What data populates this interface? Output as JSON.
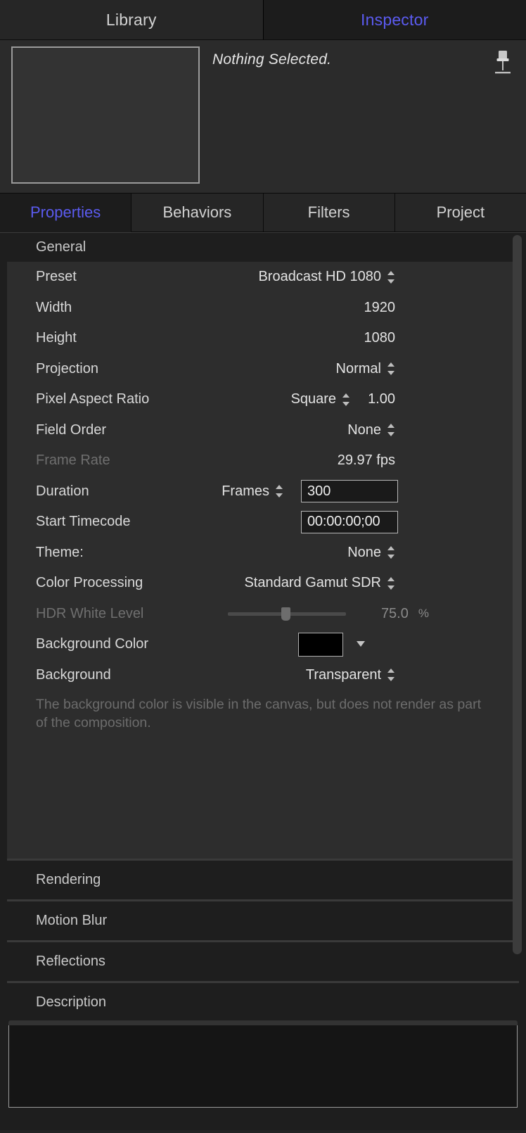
{
  "top_tabs": [
    {
      "label": "Library",
      "active": false
    },
    {
      "label": "Inspector",
      "active": true
    }
  ],
  "preview": {
    "status_text": "Nothing Selected.",
    "pin_icon": "pushpin-icon"
  },
  "inspector_tabs": [
    {
      "label": "Properties",
      "active": true
    },
    {
      "label": "Behaviors",
      "active": false
    },
    {
      "label": "Filters",
      "active": false
    },
    {
      "label": "Project",
      "active": false
    }
  ],
  "general": {
    "header": "General",
    "rows": {
      "preset": {
        "label": "Preset",
        "value": "Broadcast HD 1080"
      },
      "width": {
        "label": "Width",
        "value": "1920"
      },
      "height": {
        "label": "Height",
        "value": "1080"
      },
      "projection": {
        "label": "Projection",
        "value": "Normal"
      },
      "par": {
        "label": "Pixel Aspect Ratio",
        "value": "Square",
        "number": "1.00"
      },
      "field_order": {
        "label": "Field Order",
        "value": "None"
      },
      "frame_rate": {
        "label": "Frame Rate",
        "value": "29.97 fps"
      },
      "duration": {
        "label": "Duration",
        "unit": "Frames",
        "value": "300"
      },
      "start_tc": {
        "label": "Start Timecode",
        "value": "00:00:00;00"
      },
      "theme": {
        "label": "Theme:",
        "value": "None"
      },
      "color_proc": {
        "label": "Color Processing",
        "value": "Standard Gamut SDR"
      },
      "hdr_white": {
        "label": "HDR White Level",
        "value": "75.0",
        "unit": "%",
        "slider_pct": 49,
        "disabled": true
      },
      "bg_color": {
        "label": "Background Color",
        "swatch_hex": "#000000"
      },
      "background": {
        "label": "Background",
        "value": "Transparent"
      }
    },
    "note": "The background color is visible in the canvas, but does not render as part of the composition."
  },
  "sections": [
    {
      "label": "Rendering"
    },
    {
      "label": "Motion Blur"
    },
    {
      "label": "Reflections"
    },
    {
      "label": "Description"
    }
  ],
  "description": {
    "value": ""
  },
  "colors": {
    "accent": "#5b5bf0",
    "panel_bg": "#2d2d2d",
    "window_bg": "#1e1e1e",
    "label": "#d8d8d8",
    "dim_label": "#6f6f6f"
  }
}
